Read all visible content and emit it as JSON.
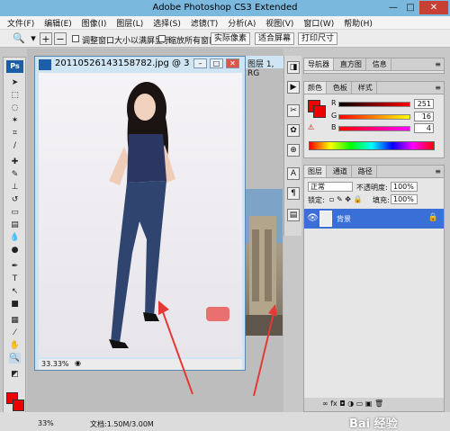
{
  "app": {
    "title": "Adobe Photoshop CS3 Extended",
    "window_buttons": {
      "minimize": "—",
      "maximize": "□",
      "close": "✕"
    }
  },
  "menu": [
    "文件(F)",
    "编辑(E)",
    "图像(I)",
    "图层(L)",
    "选择(S)",
    "滤镜(T)",
    "分析(A)",
    "视图(V)",
    "窗口(W)",
    "帮助(H)"
  ],
  "options_bar": {
    "resize_label": "调整窗口大小以满屏显示",
    "zoom_all_label": "缩放所有窗口",
    "actual_pixels": "实际像素",
    "fit_screen": "适合屏幕",
    "print_size": "打印尺寸"
  },
  "document": {
    "title": "20110526143158782.jpg @ 3...",
    "zoom": "33.33%",
    "second_tab_title": "图层 1, RG"
  },
  "panels": {
    "navigator_tabs": [
      "导航器",
      "直方图",
      "信息"
    ],
    "color_tabs": [
      "颜色",
      "色板",
      "样式"
    ],
    "color": {
      "r_label": "R",
      "g_label": "G",
      "b_label": "B",
      "r": "251",
      "g": "16",
      "b": "4"
    },
    "layers_tabs": [
      "图层",
      "通道",
      "路径"
    ],
    "blend_mode": "正常",
    "opacity_label": "不透明度:",
    "opacity_value": "100%",
    "lock_label": "锁定:",
    "fill_label": "填充:",
    "fill_value": "100%",
    "layer_name": "背景"
  },
  "status": {
    "left_zoom": "33%",
    "doc_label": "文档:1.50M/3.00M"
  },
  "watermark": "Bai 经验",
  "colors": {
    "foreground": "#e00000",
    "accent": "#3a6fd8"
  }
}
